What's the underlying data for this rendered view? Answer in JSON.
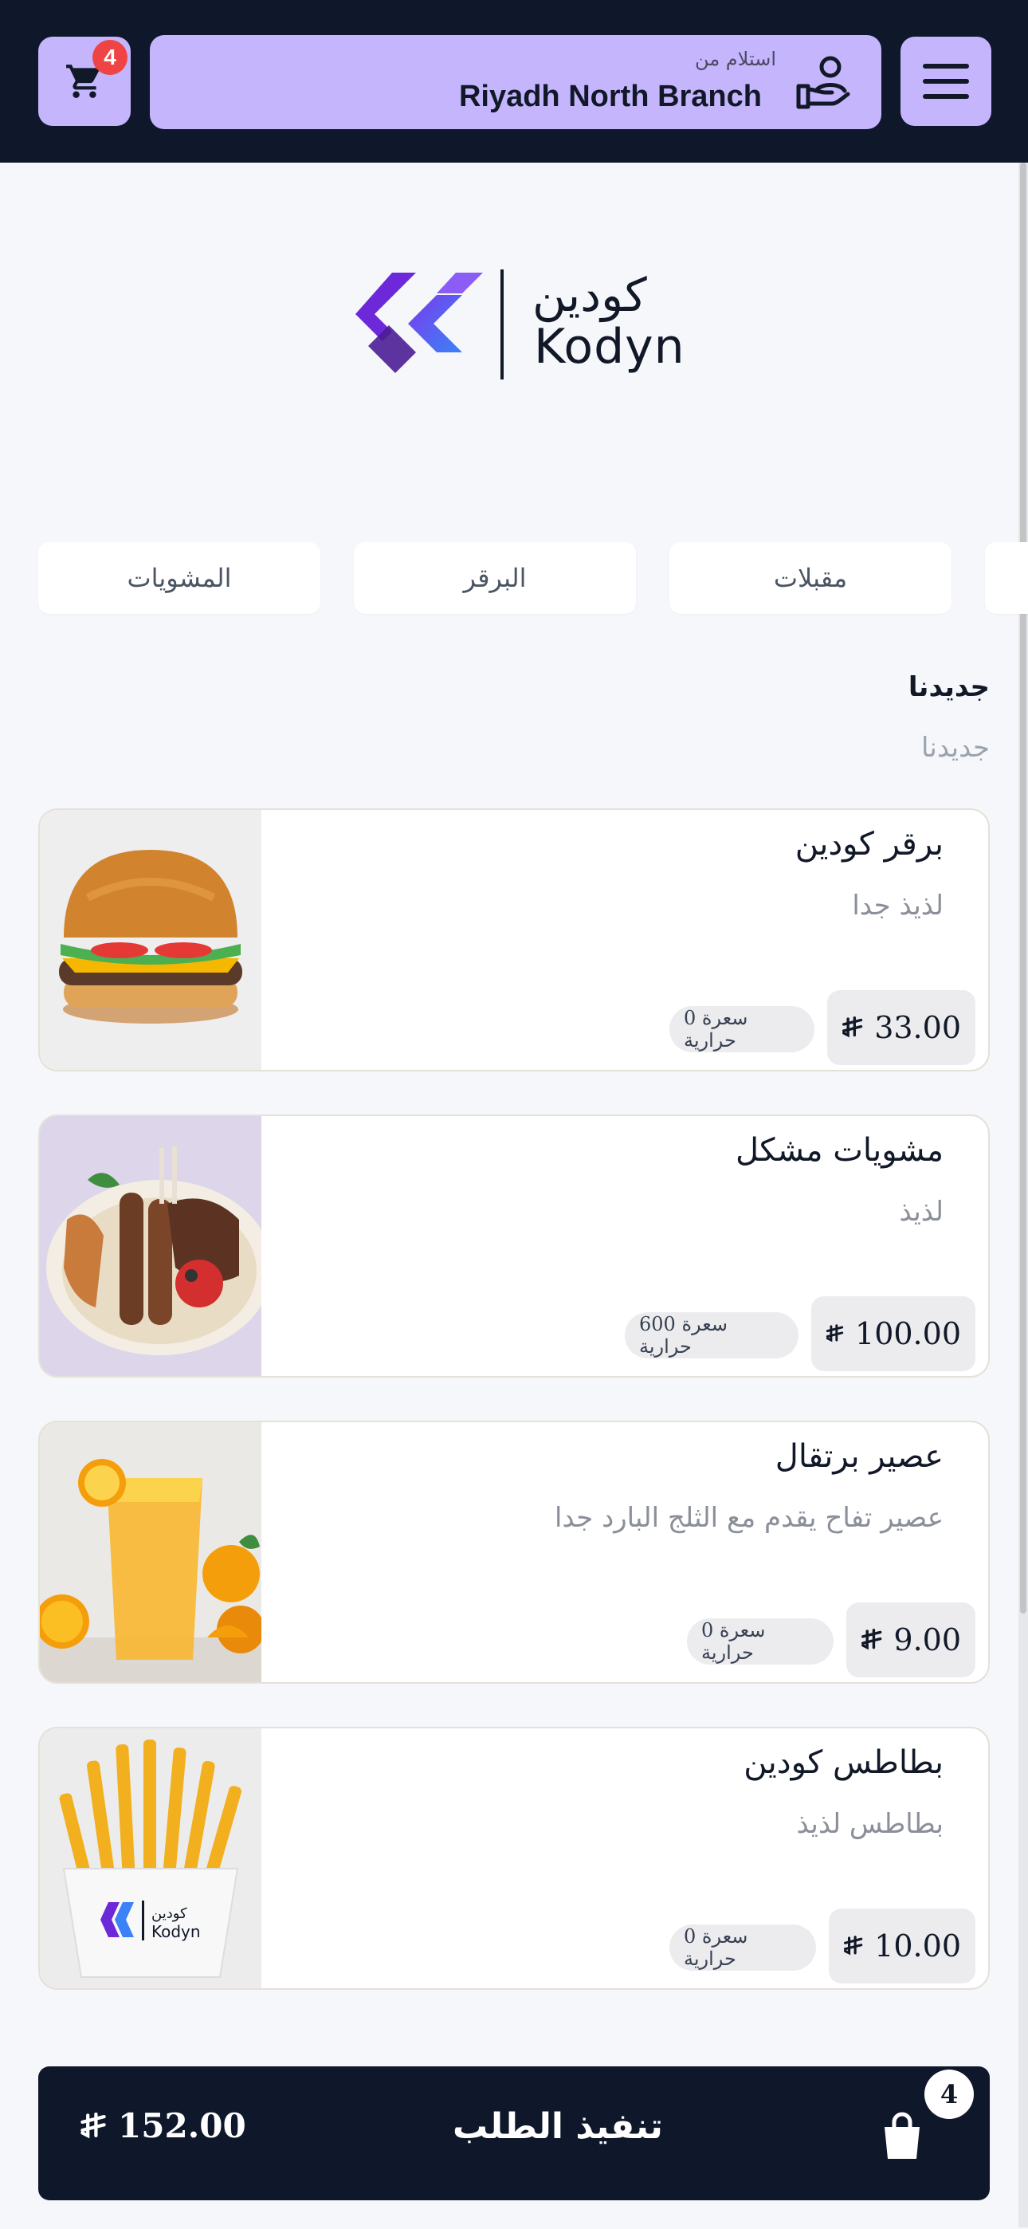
{
  "header": {
    "cart_count": "4",
    "branch_label": "استلام من",
    "branch_name": "Riyadh North Branch"
  },
  "logo": {
    "arabic": "كودين",
    "english": "Kodyn"
  },
  "tabs": [
    {
      "label": "المشويات"
    },
    {
      "label": "البرقر"
    },
    {
      "label": "مقبلات"
    }
  ],
  "section": {
    "title": "جديدنا",
    "subtitle": "جديدنا"
  },
  "products": [
    {
      "name": "برقر كودين",
      "description": "لذيذ جدا",
      "price": "33.00",
      "calories": "0 سعرة حرارية"
    },
    {
      "name": "مشويات مشكل",
      "description": "لذيذ",
      "price": "100.00",
      "calories": "600 سعرة حرارية"
    },
    {
      "name": "عصير برتقال",
      "description": "عصير تفاح يقدم مع الثلج البارد جدا",
      "price": "9.00",
      "calories": "0 سعرة حرارية"
    },
    {
      "name": "بطاطس كودين",
      "description": "بطاطس لذيذ",
      "price": "10.00",
      "calories": "0 سعرة حرارية"
    }
  ],
  "checkout": {
    "total": "152.00",
    "label": "تنفيذ الطلب",
    "count": "4"
  },
  "colors": {
    "header_bg": "#0f172a",
    "accent": "#c4b5fd",
    "badge": "#ef4444",
    "logo_purple": "#7c3aed",
    "logo_blue": "#3b82f6"
  },
  "icons": {
    "cart": "cart-icon",
    "menu": "hamburger-menu-icon",
    "pickup": "hand-user-icon",
    "bag": "shopping-bag-icon",
    "currency": "riyal-symbol-icon"
  }
}
